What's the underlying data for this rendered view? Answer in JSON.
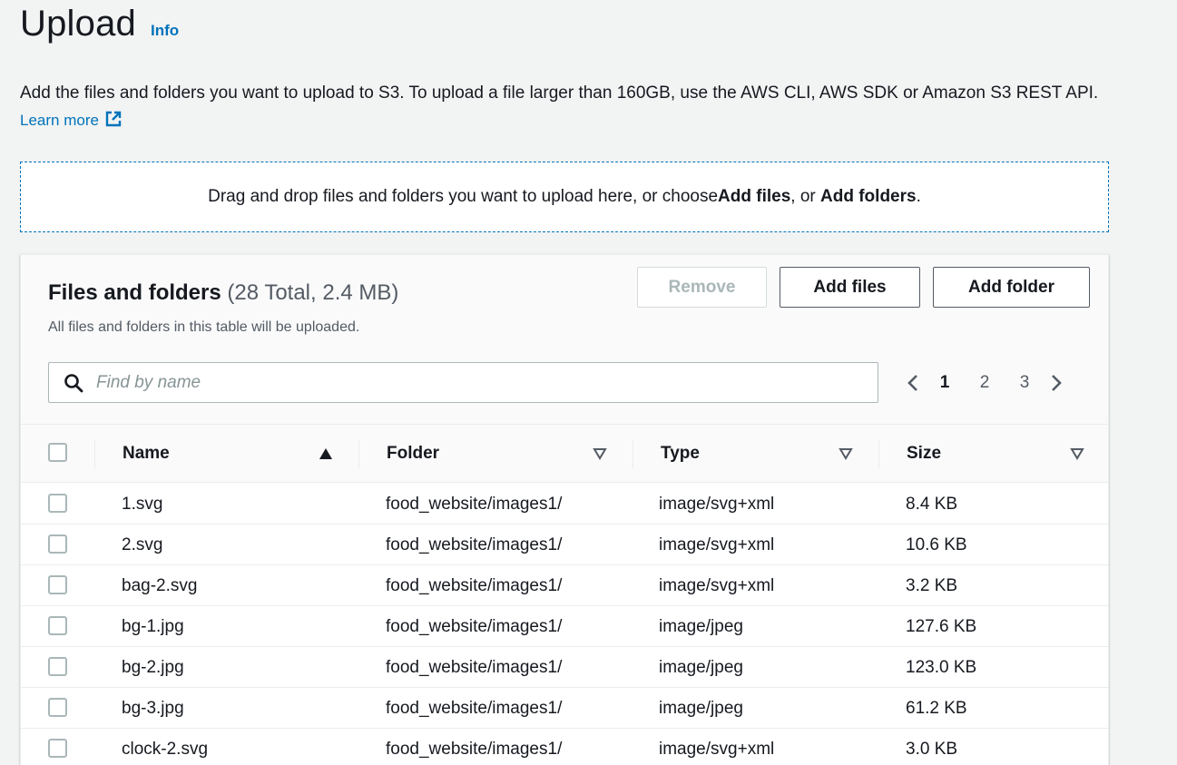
{
  "header": {
    "title": "Upload",
    "info_label": "Info"
  },
  "description": {
    "text": "Add the files and folders you want to upload to S3. To upload a file larger than 160GB, use the AWS CLI, AWS SDK or Amazon S3 REST API. ",
    "learn_more": "Learn more"
  },
  "dropzone": {
    "prefix": "Drag and drop files and folders you want to upload here, or choose ",
    "add_files": "Add files",
    "middle": ", or ",
    "add_folders": "Add folders",
    "suffix": "."
  },
  "panel": {
    "title": "Files and folders",
    "count": "(28 Total, 2.4 MB)",
    "subtitle": "All files and folders in this table will be uploaded.",
    "remove_label": "Remove",
    "add_files_label": "Add files",
    "add_folder_label": "Add folder",
    "search_placeholder": "Find by name",
    "pages": [
      "1",
      "2",
      "3"
    ],
    "current_page": "1"
  },
  "table": {
    "columns": [
      "Name",
      "Folder",
      "Type",
      "Size"
    ],
    "rows": [
      {
        "name": "1.svg",
        "folder": "food_website/images1/",
        "type": "image/svg+xml",
        "size": "8.4 KB"
      },
      {
        "name": "2.svg",
        "folder": "food_website/images1/",
        "type": "image/svg+xml",
        "size": "10.6 KB"
      },
      {
        "name": "bag-2.svg",
        "folder": "food_website/images1/",
        "type": "image/svg+xml",
        "size": "3.2 KB"
      },
      {
        "name": "bg-1.jpg",
        "folder": "food_website/images1/",
        "type": "image/jpeg",
        "size": "127.6 KB"
      },
      {
        "name": "bg-2.jpg",
        "folder": "food_website/images1/",
        "type": "image/jpeg",
        "size": "123.0 KB"
      },
      {
        "name": "bg-3.jpg",
        "folder": "food_website/images1/",
        "type": "image/jpeg",
        "size": "61.2 KB"
      },
      {
        "name": "clock-2.svg",
        "folder": "food_website/images1/",
        "type": "image/svg+xml",
        "size": "3.0 KB"
      }
    ]
  },
  "colors": {
    "link": "#0073bb",
    "text": "#16191f",
    "muted": "#545b64",
    "background": "#f2f3f3"
  }
}
